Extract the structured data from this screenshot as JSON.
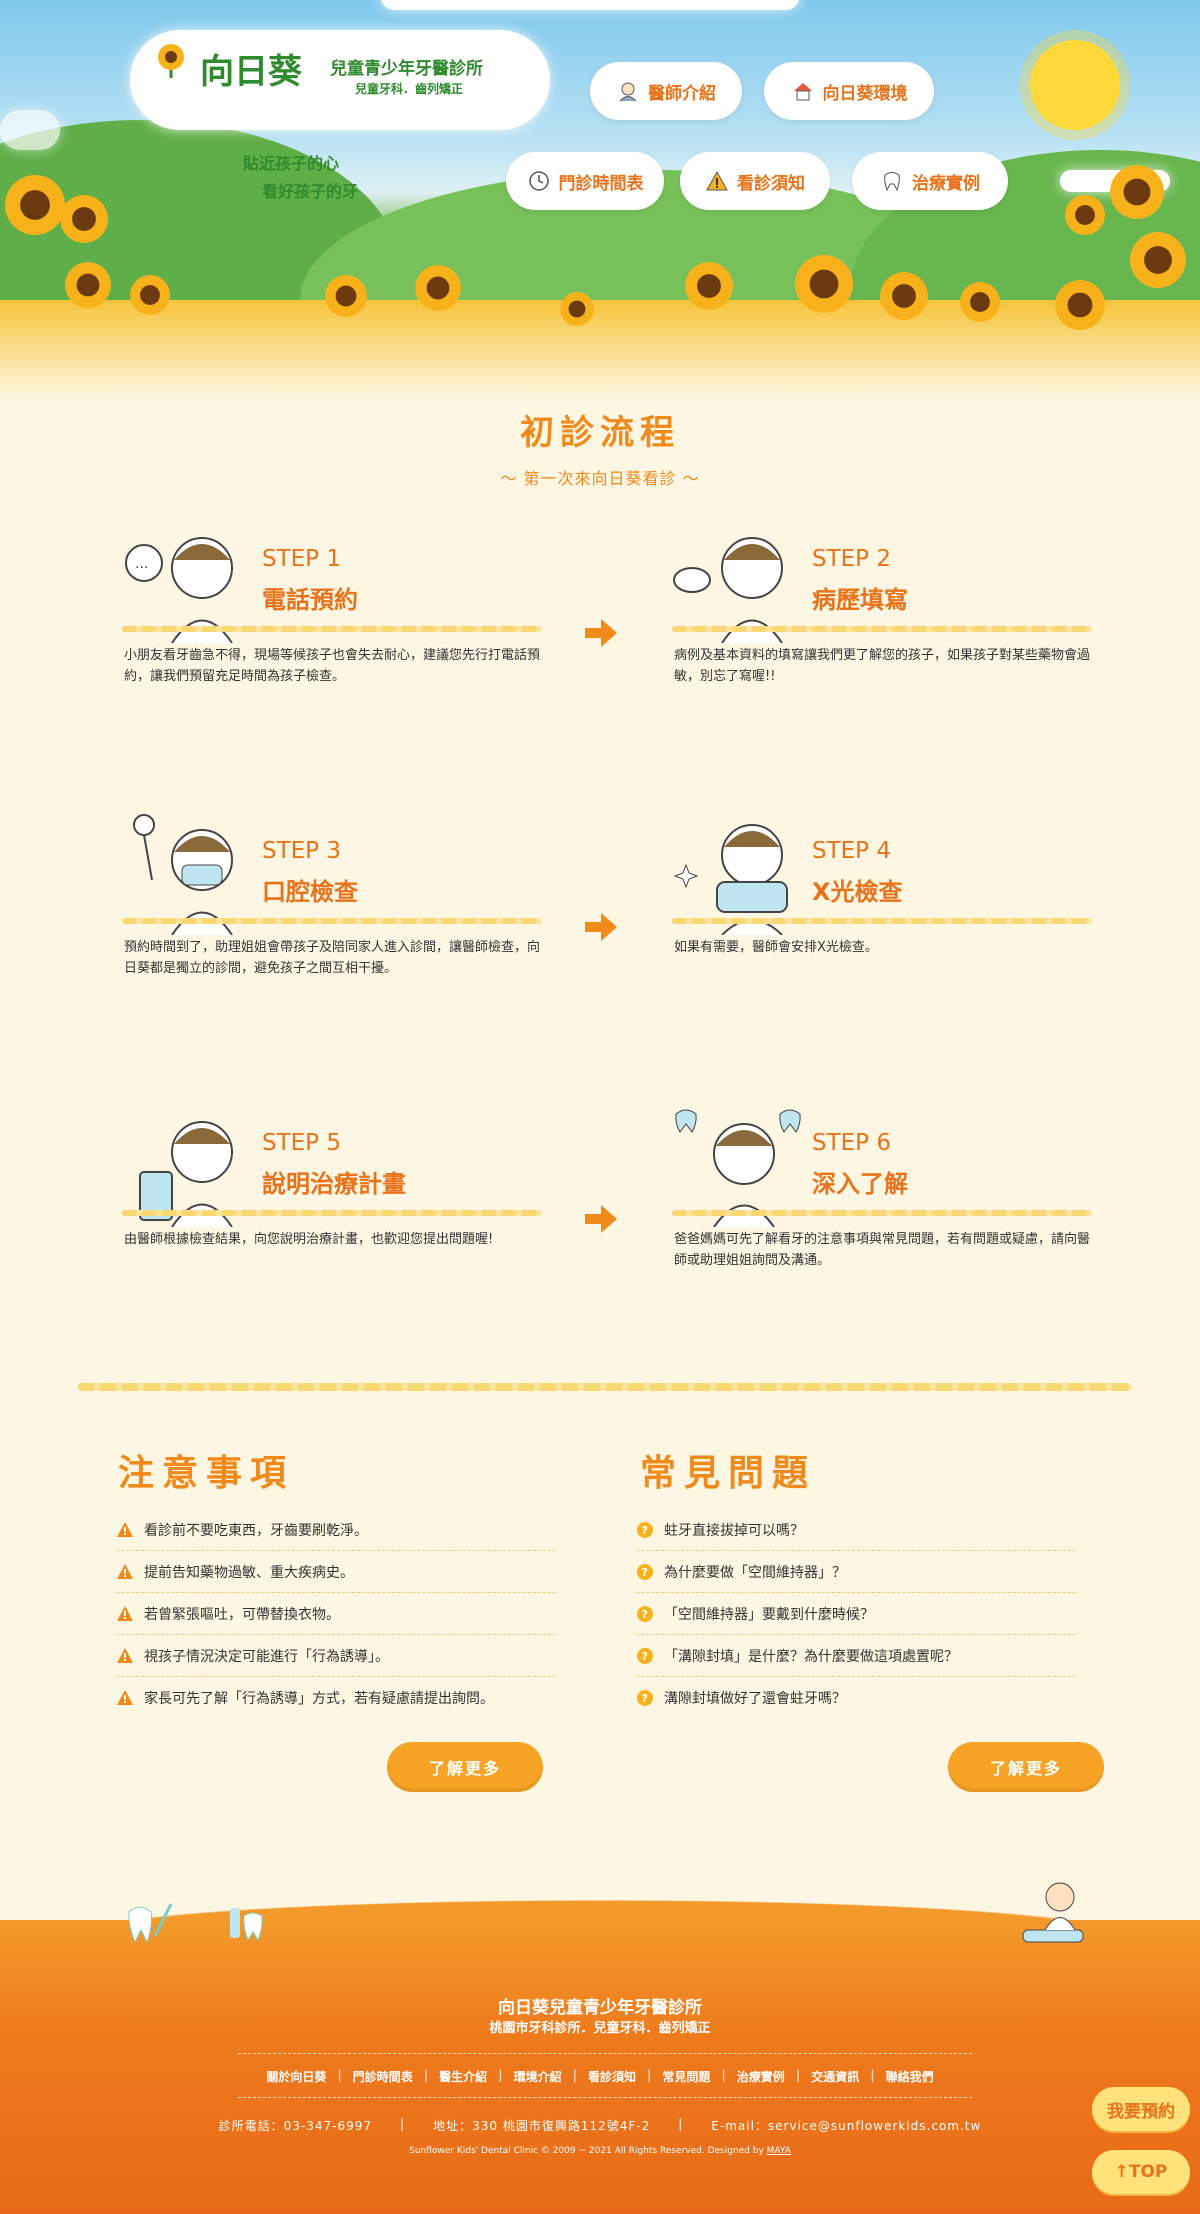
{
  "header": {
    "logo_title": "向日葵",
    "logo_sub1": "兒童青少年牙醫診所",
    "logo_sub2": "兒童牙科．齒列矯正",
    "slogan_line1": "貼近孩子的心",
    "slogan_line2": "看好孩子的牙",
    "nav": [
      {
        "label": "醫師介紹",
        "icon": "doctor-icon"
      },
      {
        "label": "向日葵環境",
        "icon": "house-icon"
      },
      {
        "label": "門診時間表",
        "icon": "clock-icon"
      },
      {
        "label": "看診須知",
        "icon": "warning-icon"
      },
      {
        "label": "治療實例",
        "icon": "tooth-icon"
      }
    ]
  },
  "process": {
    "title": "初診流程",
    "subtitle": "～ 第一次來向日葵看診 ～",
    "steps": [
      {
        "label": "STEP 1",
        "name": "電話預約",
        "desc": "小朋友看牙齒急不得，現場等候孩子也會失去耐心，建議您先行打電話預約，讓我們預留充足時間為孩子檢查。"
      },
      {
        "label": "STEP 2",
        "name": "病歷填寫",
        "desc": "病例及基本資料的填寫讓我們更了解您的孩子，如果孩子對某些藥物會過敏，別忘了寫喔!!"
      },
      {
        "label": "STEP 3",
        "name": "口腔檢查",
        "desc": "預約時間到了，助理姐姐會帶孩子及陪同家人進入診間，讓醫師檢查，向日葵都是獨立的診間，避免孩子之間互相干擾。"
      },
      {
        "label": "STEP 4",
        "name": "X光檢查",
        "desc": "如果有需要，醫師會安排X光檢查。"
      },
      {
        "label": "STEP 5",
        "name": "說明治療計畫",
        "desc": "由醫師根據檢查結果，向您說明治療計畫，也歡迎您提出問題喔!"
      },
      {
        "label": "STEP 6",
        "name": "深入了解",
        "desc": "爸爸媽媽可先了解看牙的注意事項與常見問題，若有問題或疑慮，請向醫師或助理姐姐詢問及溝通。"
      }
    ]
  },
  "notes": {
    "title": "注意事項",
    "items": [
      "看診前不要吃東西，牙齒要刷乾淨。",
      "提前告知藥物過敏、重大疾病史。",
      "若曾緊張嘔吐，可帶替換衣物。",
      "視孩子情況決定可能進行「行為誘導」。",
      "家長可先了解「行為誘導」方式，若有疑慮請提出詢問。"
    ],
    "more_label": "了解更多"
  },
  "faq": {
    "title": "常見問題",
    "items": [
      "蛀牙直接拔掉可以嗎？",
      "為什麼要做「空間維持器」？",
      "「空間維持器」要戴到什麼時候？",
      "「溝隙封填」是什麼？為什麼要做這項處置呢？",
      "溝隙封填做好了還會蛀牙嗎？"
    ],
    "more_label": "了解更多"
  },
  "footer": {
    "clinic_name": "向日葵兒童青少年牙醫診所",
    "clinic_sub": "桃園市牙科診所．兒童牙科．齒列矯正",
    "nav": [
      "關於向日葵",
      "門診時間表",
      "醫生介紹",
      "環境介紹",
      "看診須知",
      "常見問題",
      "治療實例",
      "交通資訊",
      "聯絡我們"
    ],
    "phone": "診所電話：03-347-6997",
    "address": "地址：330 桃園市復興路112號4F-2",
    "email": "E-mail：service@sunflowerkids.com.tw",
    "copyright": "Sunflower Kids' Dental Clinic © 2009 ~ 2021 All Rights Reserved. Designed by",
    "designer": "MAYA"
  },
  "floating": {
    "reserve_label": "我要預約",
    "top_label": "TOP"
  },
  "colors": {
    "accent": "#f08a1a",
    "green": "#2e8b2e",
    "bg": "#fdf6e3"
  }
}
